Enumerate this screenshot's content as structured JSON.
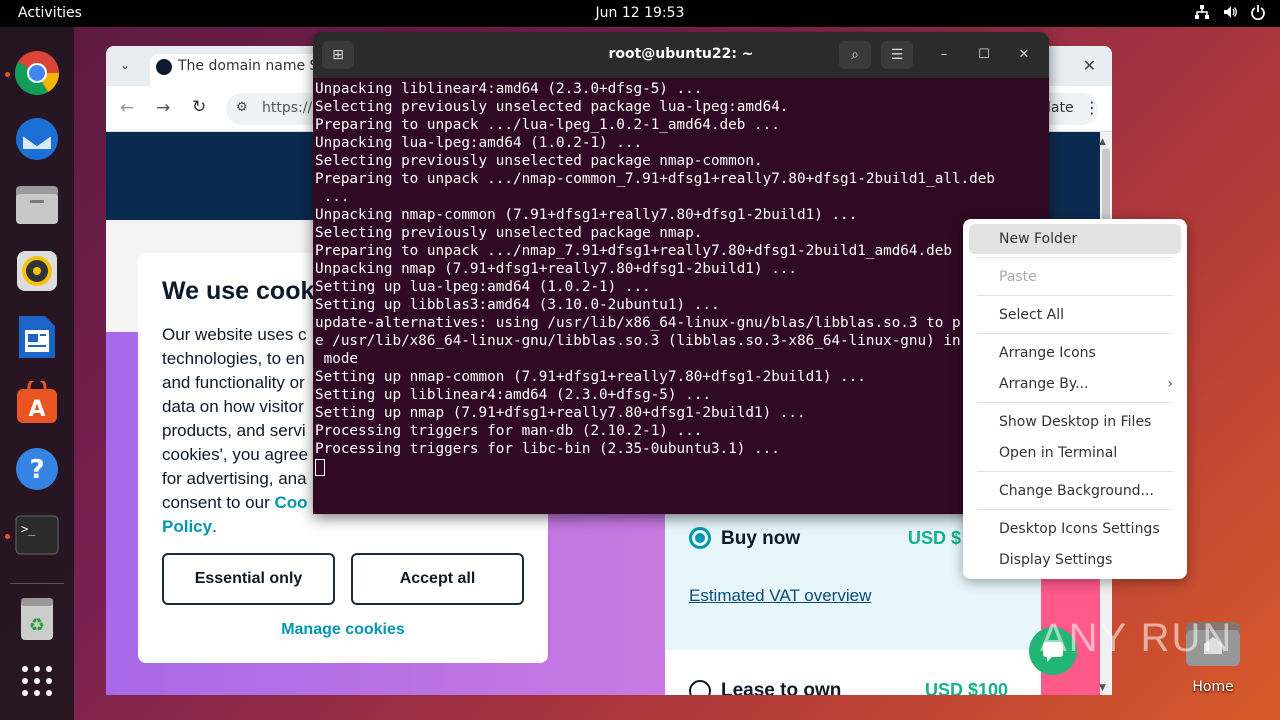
{
  "topbar": {
    "activities": "Activities",
    "clock": "Jun 12  19:53"
  },
  "dock": {
    "items": [
      {
        "name": "chrome-icon",
        "running": true
      },
      {
        "name": "thunderbird-icon",
        "running": false
      },
      {
        "name": "files-icon",
        "running": false
      },
      {
        "name": "rhythmbox-icon",
        "running": false
      },
      {
        "name": "writer-icon",
        "running": false
      },
      {
        "name": "app-center-icon",
        "running": false
      },
      {
        "name": "help-icon",
        "running": false
      },
      {
        "name": "terminal-icon",
        "running": true
      },
      {
        "name": "trash-icon",
        "running": false
      },
      {
        "name": "app-grid-icon",
        "running": false
      }
    ]
  },
  "browser": {
    "tab_title": "The domain name Si",
    "url": "https://",
    "update_label": "date",
    "cookie": {
      "title": "We use cook",
      "body_lines": [
        "Our website uses c",
        "technologies, to en",
        "and functionality or",
        "data on how visitor",
        "products, and servi",
        "cookies', you agree",
        "for advertising, ana",
        "consent to our "
      ],
      "link1": "Coo",
      "link2": "Policy",
      "period": ".",
      "essential_button": "Essential only",
      "accept_button": "Accept all",
      "manage_link": "Manage cookies"
    },
    "pricing": {
      "buy_now": "Buy now",
      "buy_price": "USD $",
      "vat_link": "Estimated VAT overview",
      "lease": "Lease to own",
      "lease_price": "USD $100"
    }
  },
  "terminal": {
    "title": "root@ubuntu22: ~",
    "lines": [
      "Unpacking liblinear4:amd64 (2.3.0+dfsg-5) ...",
      "Selecting previously unselected package lua-lpeg:amd64.",
      "Preparing to unpack .../lua-lpeg_1.0.2-1_amd64.deb ...",
      "Unpacking lua-lpeg:amd64 (1.0.2-1) ...",
      "Selecting previously unselected package nmap-common.",
      "Preparing to unpack .../nmap-common_7.91+dfsg1+really7.80+dfsg1-2build1_all.deb",
      " ...",
      "Unpacking nmap-common (7.91+dfsg1+really7.80+dfsg1-2build1) ...",
      "Selecting previously unselected package nmap.",
      "Preparing to unpack .../nmap_7.91+dfsg1+really7.80+dfsg1-2build1_amd64.deb ...",
      "Unpacking nmap (7.91+dfsg1+really7.80+dfsg1-2build1) ...",
      "Setting up lua-lpeg:amd64 (1.0.2-1) ...",
      "Setting up libblas3:amd64 (3.10.0-2ubuntu1) ...",
      "update-alternatives: using /usr/lib/x86_64-linux-gnu/blas/libblas.so.3 to provid",
      "e /usr/lib/x86_64-linux-gnu/libblas.so.3 (libblas.so.3-x86_64-linux-gnu) in auto",
      " mode",
      "Setting up nmap-common (7.91+dfsg1+really7.80+dfsg1-2build1) ...",
      "Setting up liblinear4:amd64 (2.3.0+dfsg-5) ...",
      "Setting up nmap (7.91+dfsg1+really7.80+dfsg1-2build1) ...",
      "Processing triggers for man-db (2.10.2-1) ...",
      "Processing triggers for libc-bin (2.35-0ubuntu3.1) ..."
    ]
  },
  "context_menu": {
    "new_folder": "New Folder",
    "paste": "Paste",
    "select_all": "Select All",
    "arrange_icons": "Arrange Icons",
    "arrange_by": "Arrange By...",
    "show_desktop": "Show Desktop in Files",
    "open_terminal": "Open in Terminal",
    "change_background": "Change Background...",
    "desktop_icons_settings": "Desktop Icons Settings",
    "display_settings": "Display Settings"
  },
  "desktop": {
    "home_label": "Home",
    "watermark": "ANY RUN"
  }
}
